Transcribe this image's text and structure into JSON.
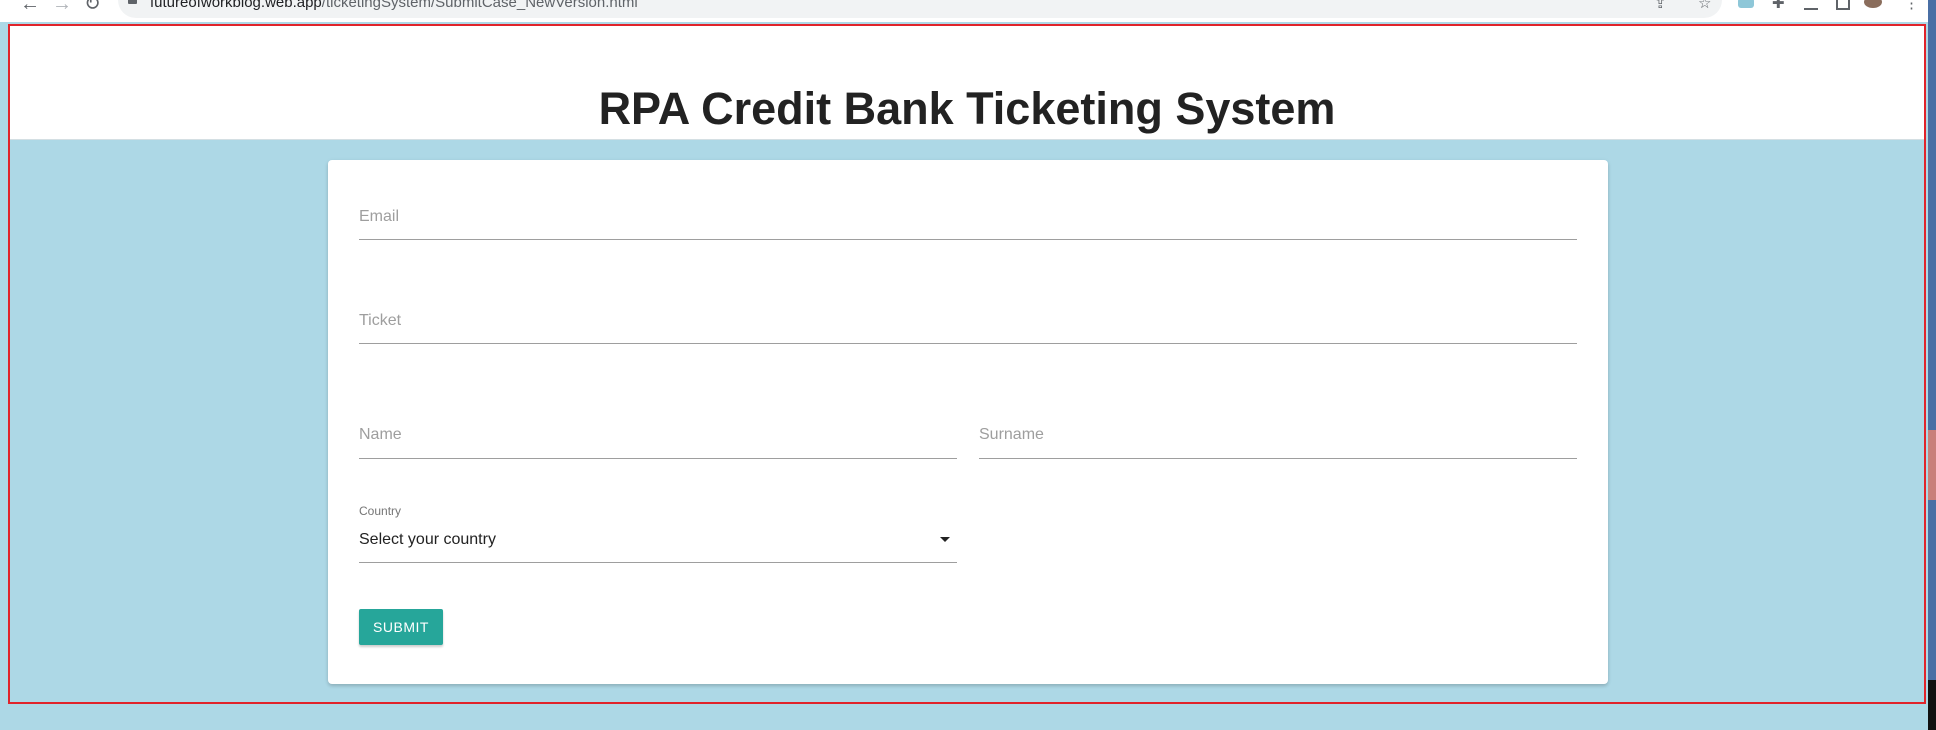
{
  "browser": {
    "url_host": "futureofworkblog.web.app",
    "url_path": "/ticketingSystem/SubmitCase_NewVersion.html",
    "back_icon": "←",
    "forward_icon": "→",
    "reload_icon": "↻",
    "share_icon": "⇪",
    "star_icon": "☆",
    "extensions_icon": "✚",
    "menu_icon": "⋮"
  },
  "page": {
    "title": "RPA Credit Bank Ticketing System"
  },
  "form": {
    "email_placeholder": "Email",
    "ticket_placeholder": "Ticket",
    "name_placeholder": "Name",
    "surname_placeholder": "Surname",
    "country_label": "Country",
    "country_value": "Select your country",
    "submit_label": "SUBMIT"
  },
  "colors": {
    "background": "#add8e6",
    "button": "#26a69a",
    "frame": "#e0242b"
  }
}
